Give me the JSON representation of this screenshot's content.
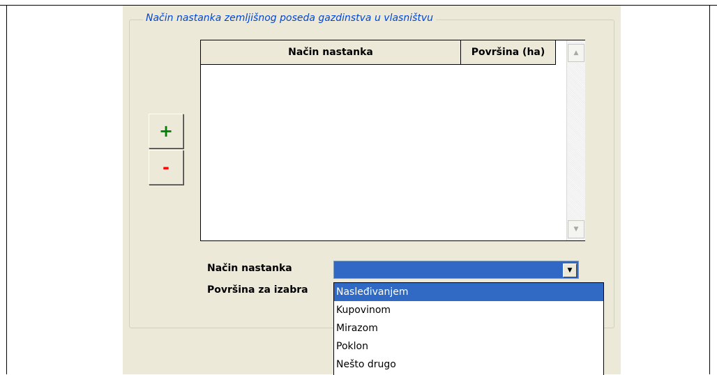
{
  "group": {
    "title": "Način nastanka zemljišnog poseda gazdinstva u vlasništvu"
  },
  "grid": {
    "columns": [
      "Način nastanka",
      "Površina (ha)"
    ],
    "rows": []
  },
  "buttons": {
    "add_label": "+",
    "remove_label": "-"
  },
  "form": {
    "nacin_label": "Način nastanka",
    "povrsina_label": "Površina za izabra",
    "nacin_value": ""
  },
  "dropdown": {
    "selected_index": 0,
    "options": [
      "Nasleđivanjem",
      "Kupovinom",
      "Mirazom",
      "Poklon",
      "Nešto drugo"
    ]
  },
  "colors": {
    "legend_text": "#0046d5",
    "selection": "#316ac5",
    "add": "#008000",
    "remove": "#ff0000",
    "panel": "#ece9d8"
  },
  "icons": {
    "scroll_up": "arrow-up-icon",
    "scroll_down": "arrow-down-icon",
    "combo": "chevron-down-icon"
  }
}
